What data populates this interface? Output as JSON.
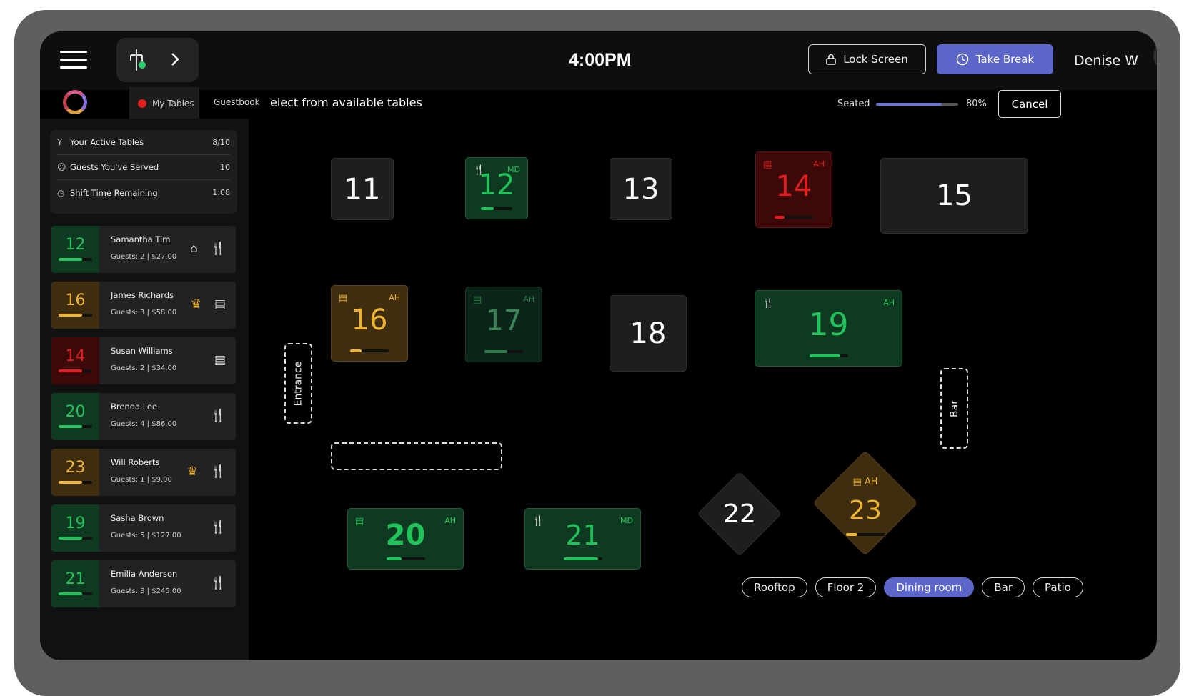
{
  "header": {
    "time": "4:00PM",
    "lock_label": "Lock Screen",
    "break_label": "Take Break",
    "user_name": "Denise W"
  },
  "subbar": {
    "tab_my_tables": "My Tables",
    "tab_guestbook": "Guestbook",
    "instruction": "elect from available tables",
    "seated_label": "Seated",
    "seated_value": "80%",
    "seated_fraction": 0.8,
    "cancel_label": "Cancel"
  },
  "stats": [
    {
      "icon": "cocktail-icon",
      "label": "Your Active Tables",
      "value": "8/10"
    },
    {
      "icon": "guests-icon",
      "label": "Guests You've Served",
      "value": "10"
    },
    {
      "icon": "clock-icon",
      "label": "Shift Time Remaining",
      "value": "1:08"
    }
  ],
  "cards": [
    {
      "table": "12",
      "name": "Samantha Tim",
      "guests": "Guests: 2",
      "amount": "$27.00",
      "color": "#22c25a",
      "box": "#0f3a22",
      "progress": 0.7,
      "icons": [
        "cake",
        "utensils"
      ]
    },
    {
      "table": "16",
      "name": "James Richards",
      "guests": "Guests: 3",
      "amount": "$58.00",
      "color": "#f0b430",
      "box": "#3e2e0f",
      "progress": 0.7,
      "icons": [
        "crown",
        "receipt"
      ]
    },
    {
      "table": "14",
      "name": "Susan Williams",
      "guests": "Guests: 2",
      "amount": "$34.00",
      "color": "#e01c1c",
      "box": "#3d0808",
      "progress": 0.7,
      "icons": [
        "receipt"
      ]
    },
    {
      "table": "20",
      "name": "Brenda Lee",
      "guests": "Guests: 4",
      "amount": "$86.00",
      "color": "#22c25a",
      "box": "#0f3a22",
      "progress": 0.7,
      "icons": [
        "utensils"
      ]
    },
    {
      "table": "23",
      "name": "Will Roberts",
      "guests": "Guests: 1",
      "amount": "$9.00",
      "color": "#f0b430",
      "box": "#3e2e0f",
      "progress": 0.7,
      "icons": [
        "crown",
        "utensils"
      ]
    },
    {
      "table": "19",
      "name": "Sasha Brown",
      "guests": "Guests: 5",
      "amount": "$127.00",
      "color": "#22c25a",
      "box": "#0f3a22",
      "progress": 0.7,
      "icons": [
        "utensils"
      ]
    },
    {
      "table": "21",
      "name": "Emilia Anderson",
      "guests": "Guests: 8",
      "amount": "$245.00",
      "color": "#22c25a",
      "box": "#0f3a22",
      "progress": 0.7,
      "icons": [
        "utensils"
      ]
    }
  ],
  "floor": {
    "tables": [
      {
        "label": "11",
        "style": "t-gray"
      },
      {
        "label": "12",
        "style": "t-green",
        "icon": "utensils",
        "tag": "MD",
        "progress": 0.4
      },
      {
        "label": "13",
        "style": "t-gray"
      },
      {
        "label": "14",
        "style": "t-red",
        "icon": "receipt",
        "tag": "AH",
        "progress": 0.25
      },
      {
        "label": "15",
        "style": "t-gray"
      },
      {
        "label": "16",
        "style": "t-gold",
        "icon": "receipt",
        "tag": "AH",
        "progress": 0.3
      },
      {
        "label": "17",
        "style": "t-green-dim",
        "icon": "receipt",
        "tag": "AH",
        "progress": 0.6
      },
      {
        "label": "18",
        "style": "t-gray"
      },
      {
        "label": "19",
        "style": "t-green",
        "icon": "utensils",
        "tag": "AH",
        "progress": 0.8
      },
      {
        "label": "20",
        "style": "t-green",
        "icon": "receipt",
        "tag": "AH",
        "progress": 0.4
      },
      {
        "label": "21",
        "style": "t-green",
        "icon": "utensils",
        "tag": "MD",
        "progress": 0.9
      }
    ],
    "diamond_22": "22",
    "diamond_23": "23",
    "diamond_23_tag": "AH",
    "diamond_23_progress": 0.3,
    "zone_entrance": "Entrance",
    "zone_bar": "Bar"
  },
  "floor_tabs": [
    "Rooftop",
    "Floor 2",
    "Dining room",
    "Bar",
    "Patio"
  ],
  "floor_tab_active": "Dining room",
  "colors": {
    "accent": "#5c66c9",
    "green": "#22c25a",
    "gold": "#f0b430",
    "red": "#e01c1c"
  }
}
